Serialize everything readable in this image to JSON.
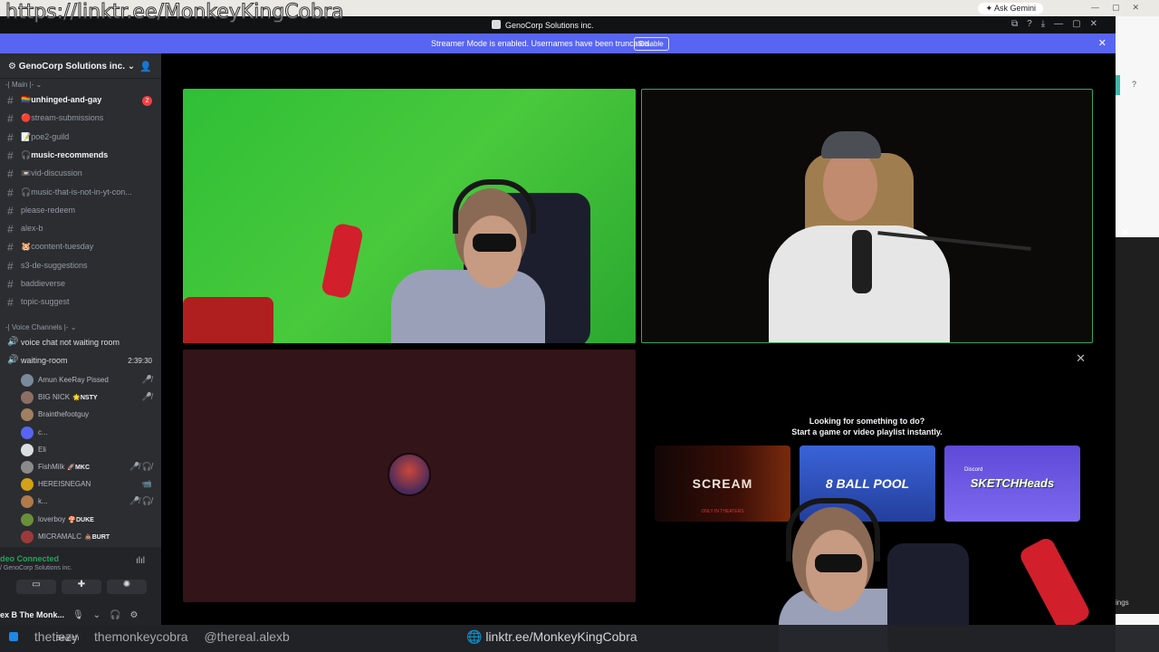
{
  "overlay_url": "https://linktr.ee/MonkeyKingCobra",
  "browser": {
    "ask_gemini": "Ask Gemini"
  },
  "window": {
    "title": "GenoCorp Solutions inc."
  },
  "streamer_banner": {
    "message": "Streamer Mode is enabled. Usernames have been truncated.",
    "disable_label": "Disable"
  },
  "server": {
    "name": "GenoCorp Solutions inc."
  },
  "categories": {
    "main": "-| Main |-",
    "voice": "-| Voice Channels |-"
  },
  "channels": [
    {
      "label": "🏳️‍🌈unhinged-and-gay",
      "bright": true,
      "badge": "2"
    },
    {
      "label": "🔴stream-submissions"
    },
    {
      "label": "📝poe2-guild"
    },
    {
      "label": "🎧music-recommends",
      "bright": true
    },
    {
      "label": "📼vid-discussion"
    },
    {
      "label": "🎧music-that-is-not-in-yt-con..."
    },
    {
      "label": "please-redeem"
    },
    {
      "label": "alex-b"
    },
    {
      "label": "🐹coontent-tuesday"
    },
    {
      "label": "s3-de-suggestions"
    },
    {
      "label": "baddieverse"
    },
    {
      "label": "topic-suggest"
    }
  ],
  "voice_channels": [
    {
      "label": "voice chat not waiting room"
    },
    {
      "label": "waiting-room",
      "timer": "2:39:30"
    }
  ],
  "voice_users": [
    {
      "name": "Amun KeeRay Pissed",
      "tag": "",
      "icon": "🎤̸"
    },
    {
      "name": "BIG NICK",
      "tag": "🌟NSTY",
      "icon": "🎤̸"
    },
    {
      "name": "Brainthefootguy",
      "tag": "",
      "icon": ""
    },
    {
      "name": "c...",
      "tag": "",
      "icon": ""
    },
    {
      "name": "Eli",
      "tag": "",
      "icon": ""
    },
    {
      "name": "FishMilk",
      "tag": "🚀MKC",
      "icon": "🎤̸ 🎧̸"
    },
    {
      "name": "HEREISNEGAN",
      "tag": "",
      "icon": "📹"
    },
    {
      "name": "k...",
      "tag": "",
      "icon": "🎤̸ 🎧̸"
    },
    {
      "name": "loverboy",
      "tag": "🍄DUKE",
      "icon": ""
    },
    {
      "name": "MICRAMALC",
      "tag": "💩BURT",
      "icon": ""
    }
  ],
  "voice_panel": {
    "status": "deo Connected",
    "guild": "/ GenoCorp Solutions inc.",
    "user": "ex B The Monk..."
  },
  "activity": {
    "line1": "Looking for something to do?",
    "line2": "Start a game or video playlist instantly.",
    "cards": [
      {
        "title": "SCREAM",
        "subtitle": "ONLY IN THEATERS"
      },
      {
        "title": "8 BALL POOL",
        "subtitle": ""
      },
      {
        "title": "SKETCHHeads",
        "subtitle": "Discord"
      }
    ]
  },
  "taskbar": {
    "search": "Search",
    "handles": [
      "thetiezy",
      "themonkeycobra",
      "@thereal.alexb"
    ],
    "link": "linktr.ee/MonkeyKingCobra"
  },
  "right_edge": {
    "label": "ings"
  },
  "colors": {
    "streamer_banner": "#5865f2",
    "green_screen": "#3ec23a",
    "speaking_border": "#3ba55c",
    "connected": "#23a55a"
  }
}
